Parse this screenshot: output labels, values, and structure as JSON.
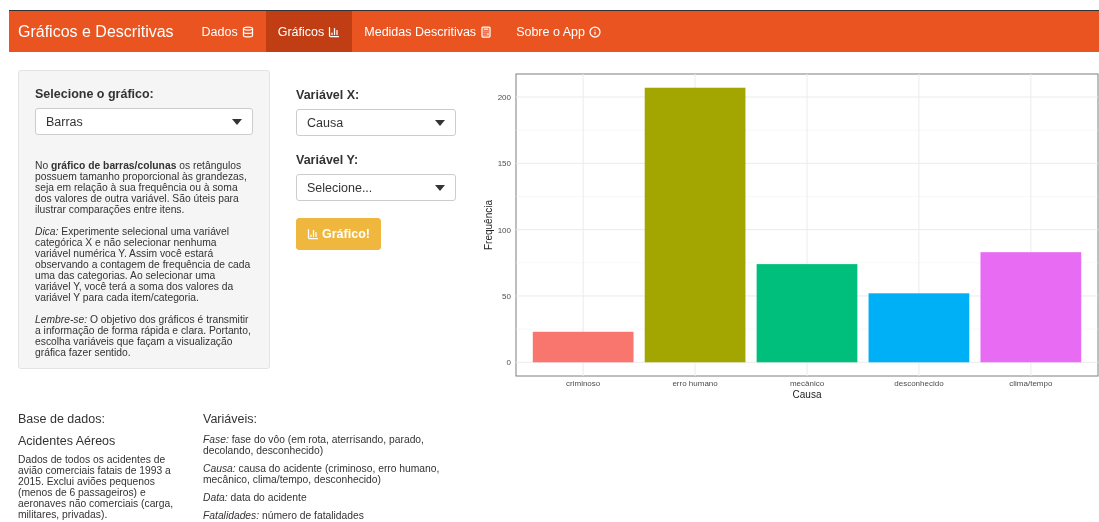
{
  "navbar": {
    "brand": "Gráficos e Descritivas",
    "items": [
      {
        "label": "Dados",
        "selected": false
      },
      {
        "label": "Gráficos",
        "selected": true
      },
      {
        "label": "Medidas Descritivas",
        "selected": false
      },
      {
        "label": "Sobre o App",
        "selected": false
      }
    ]
  },
  "sidebar": {
    "label": "Selecione o gráfico:",
    "select": {
      "value": "Barras"
    },
    "paragraphs": [
      "No **gráfico de barras/colunas** os retângulos possuem tamanho proporcional às grandezas, seja em relação à sua frequência ou à soma dos valores de outra variável. São úteis para ilustrar comparações entre itens.",
      "*Dica:* Experimente selecional uma variável categórica X e não selecionar nenhuma variável numérica Y. Assim você estará observando a contagem de frequência de cada uma das categorias. Ao selecionar uma variável Y, você terá a soma dos valores da variável Y para cada item/categoria.",
      "*Lembre-se:* O objetivo dos gráficos é transmitir a informação de forma rápida e clara. Portanto, escolha variáveis que façam a visualização gráfica fazer sentido."
    ]
  },
  "controls": {
    "x": {
      "label": "Variável X:",
      "value": "Causa"
    },
    "y": {
      "label": "Variável Y:",
      "value": "Selecione..."
    },
    "button": "Gráfico!"
  },
  "chart": {
    "chart_data": {
      "type": "bar",
      "xlabel": "Causa",
      "ylabel": "Frequência",
      "categories": [
        "criminoso",
        "erro humano",
        "mecânico",
        "desconhecido",
        "clima/tempo"
      ],
      "series": [
        {
          "color": "#f8766d",
          "values": [
            23,
            null,
            null,
            null,
            null
          ]
        },
        {
          "color": "#a3a500",
          "values": [
            null,
            207,
            null,
            null,
            null
          ]
        },
        {
          "color": "#00bf7d",
          "values": [
            null,
            null,
            74,
            null,
            null
          ]
        },
        {
          "color": "#00b0f6",
          "values": [
            null,
            null,
            null,
            52,
            null
          ]
        },
        {
          "color": "#e76bf3",
          "values": [
            null,
            null,
            null,
            null,
            83
          ]
        }
      ],
      "stacked": true,
      "grid": true,
      "ylim": [
        -10.35,
        217.35
      ],
      "yticks": [
        0,
        50,
        100,
        150,
        200
      ]
    }
  },
  "dataset": {
    "heading": "Base de dados:",
    "title": "Acidentes Aéreos",
    "description": "Dados de todos os acidentes de avião comerciais fatais de 1993 a 2015. Exclui aviões pequenos (menos de 6 passageiros) e aeronaves não comerciais (carga, militares, privadas)."
  },
  "variables": {
    "heading": "Variáveis:",
    "items": [
      "*Fase:* fase do vôo (em rota, aterrisando, parado, decolando, desconhecido)",
      "*Causa:* causa do acidente (criminoso, erro humano, mecânico, clima/tempo, desconhecido)",
      "*Data:* data do acidente",
      "*Fatalidades:* número de fatalidades"
    ]
  }
}
